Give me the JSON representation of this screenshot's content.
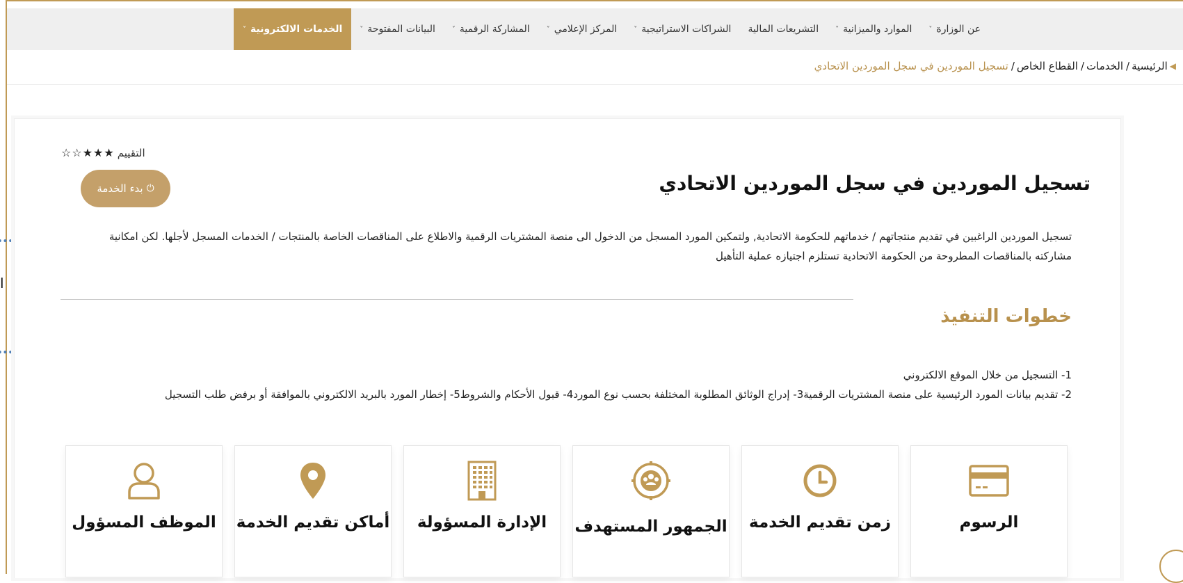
{
  "nav": {
    "items": [
      {
        "label": "عن الوزارة",
        "has_menu": true
      },
      {
        "label": "الموارد والميزانية",
        "has_menu": true
      },
      {
        "label": "التشريعات المالية",
        "has_menu": false
      },
      {
        "label": "الشراكات الاستراتيجية",
        "has_menu": true
      },
      {
        "label": "المركز الإعلامي",
        "has_menu": true
      },
      {
        "label": "المشاركة الرقمية",
        "has_menu": true
      },
      {
        "label": "البيانات المفتوحة",
        "has_menu": true
      },
      {
        "label": "الخدمات الالكترونية",
        "has_menu": true,
        "active": true
      }
    ],
    "chevron": "˅"
  },
  "breadcrumb": {
    "items": [
      "الرئيسية",
      "الخدمات",
      "القطاع الخاص"
    ],
    "separator": "/",
    "current": "تسجيل الموردين في سجل الموردين الاتحادي"
  },
  "service": {
    "title": "تسجيل الموردين في سجل الموردين الاتحادي",
    "rating_label": "التقييم",
    "rating_stars": "★★★☆☆",
    "rating_value": 3,
    "rating_max": 5,
    "start_button": "بدء الخدمة",
    "description": "تسجيل الموردين الراغبين في تقديم منتجاتهم / خدماتهم للحكومة الاتحادية, ولتمكين المورد المسجل من الدخول الى منصة المشتريات الرقمية والاطلاع على المناقصات الخاصة بالمنتجات / الخدمات المسجل لأجلها. لكن امكانية مشاركته بالمناقصات المطروحة من الحكومة الاتحادية تستلزم اجتيازه عملية التأهيل",
    "steps_heading": "خطوات التنفيذ",
    "steps": [
      "1- التسجيل من خلال الموقع الالكتروني",
      "2- تقديم بيانات المورد الرئيسية على منصة المشتريات الرقمية3- إدراج الوثائق المطلوبة المختلفة بحسب نوع المورد4- قبول الأحكام والشروط5- إخطار المورد بالبريد الالكتروني بالموافقة أو برفض طلب التسجيل"
    ]
  },
  "info_boxes": [
    {
      "label": "الرسوم",
      "icon": "credit-card-icon"
    },
    {
      "label": "زمن تقديم الخدمة",
      "icon": "clock-icon"
    },
    {
      "label": "الجمهور المستهدف",
      "icon": "audience-icon"
    },
    {
      "label": "الإدارة المسؤولة",
      "icon": "building-icon"
    },
    {
      "label": "أماكن تقديم الخدمة",
      "icon": "location-pin-icon"
    },
    {
      "label": "الموظف المسؤول",
      "icon": "user-icon"
    }
  ],
  "annotation": {
    "text": "ا"
  },
  "colors": {
    "accent": "#c09a55",
    "accent_dark": "#b8914d",
    "button": "#c4a06a",
    "annotation_blue": "#4f7fb6",
    "nav_bg": "#efefef"
  }
}
